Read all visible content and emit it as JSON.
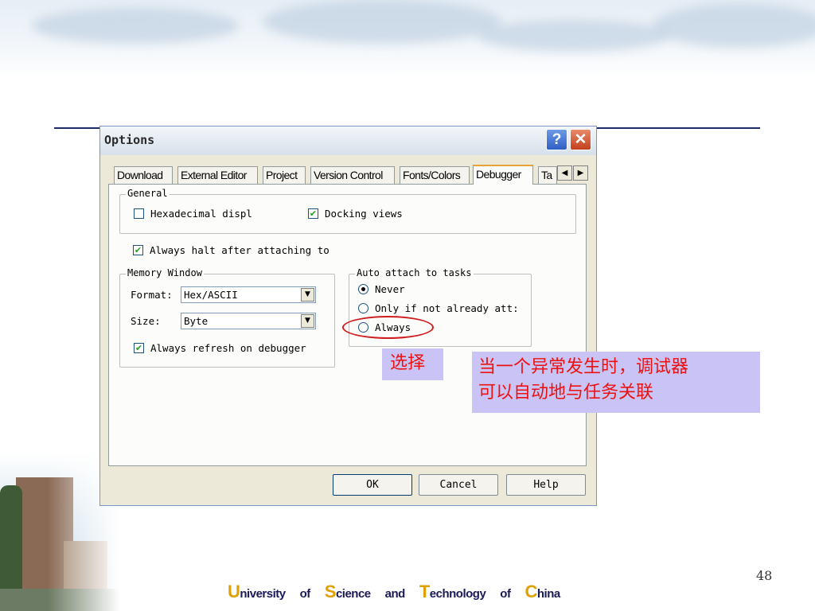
{
  "dialog": {
    "title": "Options",
    "help_glyph": "?",
    "close_glyph": "✕",
    "tabs": [
      {
        "label": "Download",
        "active": false
      },
      {
        "label": "External Editor",
        "active": false
      },
      {
        "label": "Project",
        "active": false
      },
      {
        "label": "Version Control",
        "active": false
      },
      {
        "label": "Fonts/Colors",
        "active": false
      },
      {
        "label": "Debugger",
        "active": true
      },
      {
        "label": "Ta",
        "active": false
      }
    ],
    "general": {
      "label": "General",
      "hex_display": {
        "label": "Hexadecimal displ",
        "checked": false
      },
      "docking_views": {
        "label": "Docking views",
        "checked": true
      }
    },
    "always_halt": {
      "label": "Always halt after attaching to",
      "checked": true
    },
    "memory_window": {
      "label": "Memory Window",
      "format_label": "Format:",
      "format_value": "Hex/ASCII",
      "size_label": "Size:",
      "size_value": "Byte",
      "always_refresh": {
        "label": "Always refresh on debugger",
        "checked": true
      }
    },
    "auto_attach": {
      "label": "Auto attach to tasks",
      "options": [
        {
          "label": "Never",
          "selected": true
        },
        {
          "label": "Only if not already att:",
          "selected": false
        },
        {
          "label": "Always",
          "selected": false
        }
      ]
    },
    "buttons": {
      "ok": "OK",
      "cancel": "Cancel",
      "help": "Help"
    }
  },
  "annotations": {
    "select_note": "选择",
    "explain_line1": "当一个异常发生时，调试器",
    "explain_line2": "可以自动地与任务关联",
    "ellipse_color": "#d01c1c",
    "note_bg": "#c9c4f5",
    "note_text_color": "#e11111"
  },
  "slide": {
    "page_number": "48",
    "footer": {
      "w1_initial": "U",
      "w1_rest": "niversity",
      "w2": "of",
      "w3_initial": "S",
      "w3_rest": "cience",
      "w4": "and",
      "w5_initial": "T",
      "w5_rest": "echnology",
      "w6": "of",
      "w7_initial": "C",
      "w7_rest": "hina"
    }
  }
}
